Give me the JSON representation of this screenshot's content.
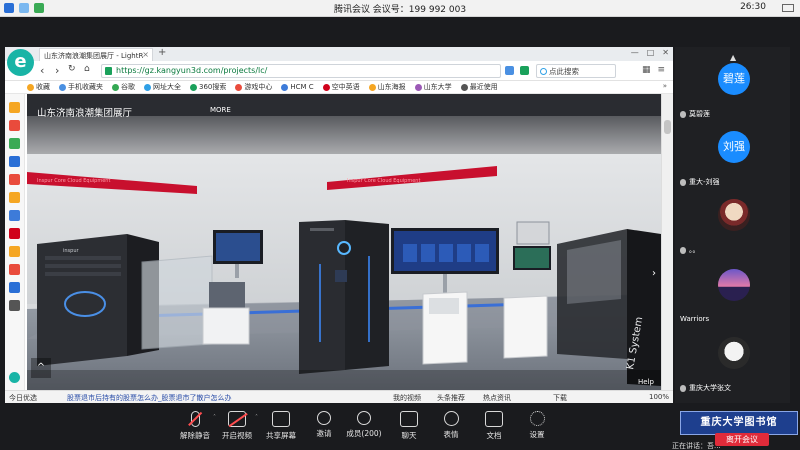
{
  "meeting": {
    "title": "腾讯会议 会议号：199 992 003",
    "clock": "26:30"
  },
  "browser": {
    "tab_title": "山东济南浪潮集团展厅 - LightR",
    "tab_close": "×",
    "new_tab": "+",
    "url": "https://gz.kangyun3d.com/projects/lc/",
    "search_placeholder": "点此搜索",
    "bookmarks": [
      {
        "label": "收藏",
        "color": "#f5a623"
      },
      {
        "label": "手机收藏夹",
        "color": "#4a90e2"
      },
      {
        "label": "谷歌",
        "color": "#34a853"
      },
      {
        "label": "网址大全",
        "color": "#2fa0e6"
      },
      {
        "label": "360搜索",
        "color": "#1aa15b"
      },
      {
        "label": "游戏中心",
        "color": "#e94b3c"
      },
      {
        "label": "HCM C",
        "color": "#3d7bd9"
      },
      {
        "label": "空中英语",
        "color": "#d0021b"
      },
      {
        "label": "山东海报",
        "color": "#f5a623"
      },
      {
        "label": "山东大学",
        "color": "#9b59b6"
      },
      {
        "label": "最近使用",
        "color": "#555555"
      }
    ],
    "bookmark_more": "»",
    "status_news": "股票退市后持有的股票怎么办_股票退市了散户怎么办",
    "status_items": [
      "我的视频",
      "头条推荐",
      "热点资讯",
      "下载",
      "100%"
    ],
    "status_left": "今日优选"
  },
  "viewer": {
    "title": "山东济南浪潮集团展厅",
    "more": "MORE",
    "help": "Help",
    "brand": "inspur",
    "k1": "K1 System",
    "banner_left": "Inspur Core Cloud Equipment",
    "banner_right": "Inspur Core Cloud Equipment"
  },
  "participants": [
    {
      "avatar_text": "碧莲",
      "name": "莫碧莲",
      "kind": "text"
    },
    {
      "avatar_text": "刘强",
      "name": "重大-刘强",
      "kind": "text"
    },
    {
      "avatar_text": "",
      "name": "。。",
      "kind": "art"
    },
    {
      "avatar_text": "",
      "name": "Warriors",
      "kind": "sunset"
    },
    {
      "avatar_text": "",
      "name": "重庆大学张文",
      "kind": "anime"
    }
  ],
  "toolbar": {
    "mute": "解除静音",
    "video": "开启视频",
    "share": "共享屏幕",
    "invite": "邀请",
    "members": "成员(200)",
    "chat": "聊天",
    "emoji": "表情",
    "docs": "文档",
    "settings": "设置"
  },
  "footer": {
    "watermark": "重庆大学图书馆",
    "leave": "离开会议",
    "speaking": "正在讲话：吾..."
  },
  "colors": {
    "accent": "#1a8cff",
    "leave": "#e02b3a",
    "teal": "#19b4a6"
  }
}
